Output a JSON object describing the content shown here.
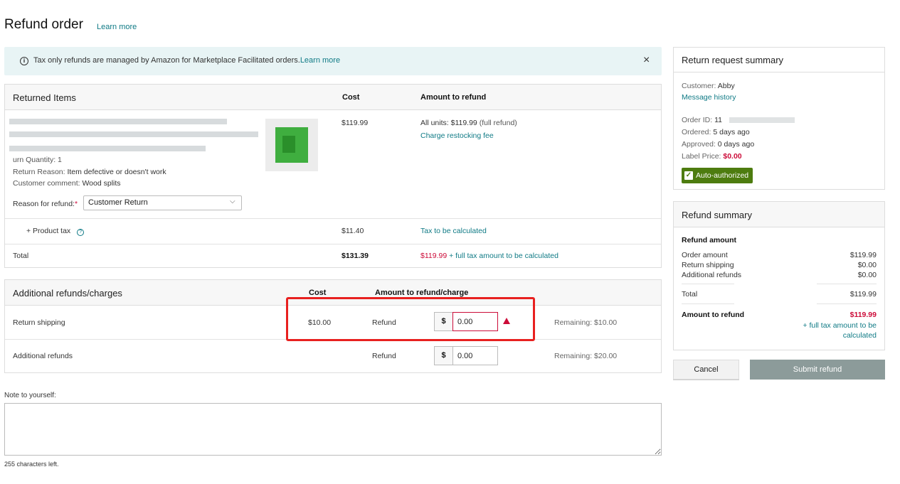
{
  "header": {
    "title": "Refund order",
    "learn_more": "Learn more"
  },
  "banner": {
    "text": "Tax only refunds are managed by Amazon for Marketplace Facilitated orders.",
    "link": "Learn more",
    "icon": "info-icon",
    "close": "×"
  },
  "returned_items": {
    "title": "Returned Items",
    "col_cost": "Cost",
    "col_amount": "Amount to refund",
    "item": {
      "return_quantity": "urn Quantity: 1",
      "return_reason_label": "Return Reason:",
      "return_reason": "Item defective or doesn't work",
      "customer_comment_label": "Customer comment:",
      "customer_comment": "Wood splits",
      "cost": "$119.99",
      "amount": "All units: $119.99",
      "amount_note": "(full refund)",
      "restocking_link": "Charge restocking fee",
      "reason_label": "Reason for refund:",
      "reason_required": "*",
      "reason_value": "Customer Return"
    },
    "tax": {
      "label": "+ Product tax",
      "cost": "$11.40",
      "amount": "Tax to be calculated"
    },
    "total": {
      "label": "Total",
      "cost": "$131.39",
      "amount_red": "$119.99",
      "amount_rest": "+ full tax amount to be calculated"
    }
  },
  "additional": {
    "title": "Additional refunds/charges",
    "col_cost": "Cost",
    "col_amount": "Amount to refund/charge",
    "rows": [
      {
        "label": "Return shipping",
        "cost": "$10.00",
        "type": "Refund",
        "currency": "$",
        "value": "0.00",
        "remaining": "Remaining: $10.00"
      },
      {
        "label": "Additional refunds",
        "cost": "",
        "type": "Refund",
        "currency": "$",
        "value": "0.00",
        "remaining": "Remaining: $20.00"
      }
    ]
  },
  "note": {
    "label": "Note to yourself:",
    "chars_left": "255 characters left."
  },
  "return_summary": {
    "title": "Return request summary",
    "customer_label": "Customer:",
    "customer": "Abby",
    "message_history": "Message history",
    "order_id_label": "Order ID:",
    "order_id": "11",
    "ordered_label": "Ordered:",
    "ordered": "5 days ago",
    "approved_label": "Approved:",
    "approved": "0 days ago",
    "label_price_label": "Label Price:",
    "label_price": "$0.00",
    "badge": "Auto-authorized"
  },
  "refund_summary": {
    "title": "Refund summary",
    "subtitle": "Refund amount",
    "order_amount_label": "Order amount",
    "order_amount": "$119.99",
    "return_shipping_label": "Return shipping",
    "return_shipping": "$0.00",
    "additional_label": "Additional refunds",
    "additional": "$0.00",
    "total_label": "Total",
    "total": "$119.99",
    "amount_label": "Amount to refund",
    "amount": "$119.99",
    "tax_note_1": "+ full tax amount to be",
    "tax_note_2": "calculated"
  },
  "buttons": {
    "cancel": "Cancel",
    "submit": "Submit refund"
  },
  "colors": {
    "accent": "#0f7a85",
    "red": "#cc0c39",
    "badge": "#4d7c0f",
    "highlight": "#e8201f"
  }
}
